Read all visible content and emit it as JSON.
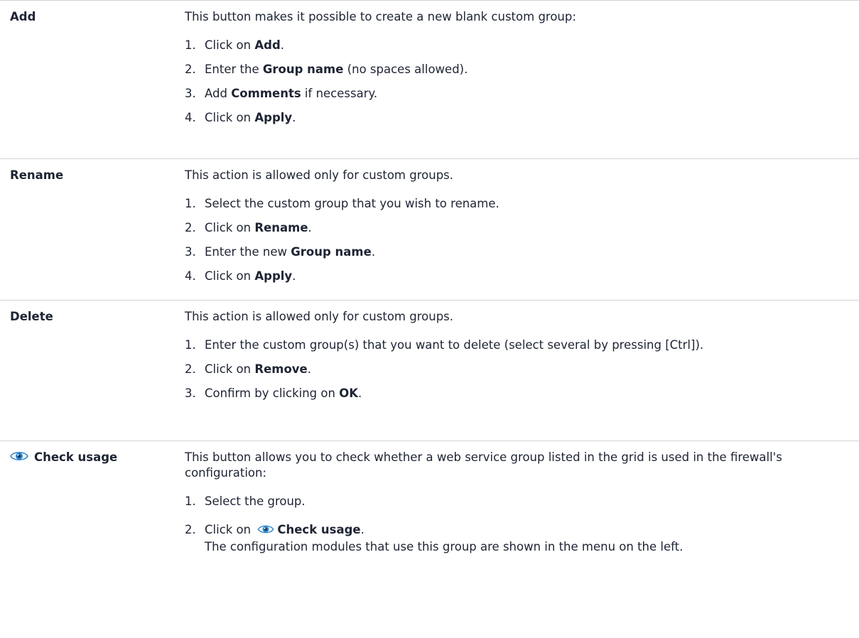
{
  "rows": [
    {
      "term": "Add",
      "intro": "This button makes it possible to create a new blank custom group:",
      "steps": [
        {
          "num": "1.",
          "pre": "Click on ",
          "bold": "Add",
          "post": "."
        },
        {
          "num": "2.",
          "pre": "Enter the ",
          "bold": "Group name",
          "post": " (no spaces allowed)."
        },
        {
          "num": "3.",
          "pre": "Add ",
          "bold": "Comments",
          "post": " if necessary."
        },
        {
          "num": "4.",
          "pre": "Click on ",
          "bold": "Apply",
          "post": "."
        }
      ]
    },
    {
      "term": "Rename",
      "intro": "This action is allowed only for custom groups.",
      "steps": [
        {
          "num": "1.",
          "pre": "Select the custom group that you wish to rename.",
          "bold": "",
          "post": ""
        },
        {
          "num": "2.",
          "pre": "Click on ",
          "bold": "Rename",
          "post": "."
        },
        {
          "num": "3.",
          "pre": "Enter the new ",
          "bold": "Group name",
          "post": "."
        },
        {
          "num": "4.",
          "pre": "Click on ",
          "bold": "Apply",
          "post": "."
        }
      ]
    },
    {
      "term": "Delete",
      "intro": "This action is allowed only for custom groups.",
      "steps": [
        {
          "num": "1.",
          "pre": "Enter the custom group(s) that you want to delete (select several by pressing [Ctrl]).",
          "bold": "",
          "post": ""
        },
        {
          "num": "2.",
          "pre": "Click on ",
          "bold": "Remove",
          "post": "."
        },
        {
          "num": "3.",
          "pre": "Confirm by clicking on ",
          "bold": "OK",
          "post": "."
        }
      ]
    },
    {
      "term": "Check usage",
      "icon": "eye-icon",
      "intro": "This button allows you to check whether a web service group listed in the grid is used in the firewall's configuration:",
      "step1": {
        "num": "1.",
        "text": "Select the group."
      },
      "step2": {
        "num": "2.",
        "pre": "Click on",
        "bold": "Check usage",
        "post": ".",
        "note": "The configuration modules that use this group are shown in the menu on the left."
      }
    }
  ],
  "colors": {
    "text": "#1e2433",
    "divider": "#cfd3d8",
    "eye_blue": "#2f86c9"
  }
}
